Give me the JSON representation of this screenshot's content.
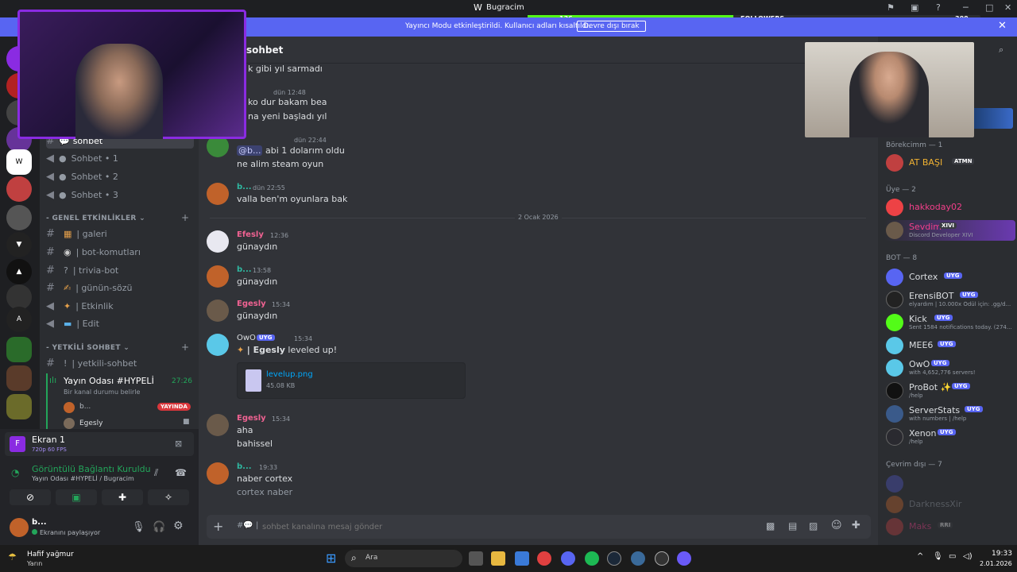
{
  "window": {
    "title": "Bugracim"
  },
  "followers": {
    "current": "136",
    "label": "FOLLOWERS",
    "goal": "300"
  },
  "banner": {
    "message": "Yayıncı Modu etkinleştirildi. Kullanıcı adları kısaltıldı.",
    "button": "Devre dışı bırak"
  },
  "channel_header": {
    "name": "sohbet"
  },
  "channels": {
    "list1": [
      {
        "name": "sohbet",
        "icon": "message-icon"
      },
      {
        "name": "Sohbet • 1",
        "icon": "speaker-icon"
      },
      {
        "name": "Sohbet • 2",
        "icon": "speaker-icon"
      },
      {
        "name": "Sohbet • 3",
        "icon": "speaker-icon"
      }
    ],
    "cat_events": "GENEL ETKİNLİKLER",
    "list2": [
      {
        "name": "galeri"
      },
      {
        "name": "bot-komutları"
      },
      {
        "name": "trivia-bot"
      },
      {
        "name": "günün-sözü"
      },
      {
        "name": "Etkinlik"
      },
      {
        "name": "Edit"
      }
    ],
    "cat_staff": "YETKİLİ SOHBET",
    "list3": [
      {
        "name": "yetkili-sohbet"
      }
    ],
    "voice_room": "Yayın Odası #HYPELİ",
    "voice_time": "27:26",
    "voice_status": "Bir kanal durumu belirle",
    "voice_users": [
      {
        "name": "b..."
      },
      {
        "name": "Egesly"
      }
    ],
    "live_badge": "YAYINDA"
  },
  "screen_panel": {
    "title": "Ekran 1",
    "quality": "720p 60 FPS"
  },
  "connection": {
    "status": "Görüntülü Bağlantı Kuruldu",
    "path": "Yayın Odası #HYPELİ / Bugracim"
  },
  "user_panel": {
    "name": "b...",
    "status": "Ekranını paylaşıyor"
  },
  "messages": {
    "m1": "k gibi yıl sarmadı",
    "m2_time": "dün 12:48",
    "m2a": "ko dur bakam bea",
    "m2b": "na yeni başladı yıl",
    "m3_time": "dün 22:44",
    "m3_mention": "@b...",
    "m3a": "abi 1 dolarım oldu",
    "m3b": "ne alim steam oyun",
    "m4_user": "b...",
    "m4_time": "dün 22:55",
    "m4": "valla ben'm oyunlara bak",
    "divider": "2 Ocak 2026",
    "m5_user": "Efesly",
    "m5_time": "12:36",
    "m5": "günaydın",
    "m6_user": "b...",
    "m6_time": "13:58",
    "m6": "günaydın",
    "m7_user": "Egesly",
    "m7_time": "15:34",
    "m7": "günaydın",
    "m8_user": "OwO",
    "m8_badge": "UYG",
    "m8_time": "15:34",
    "m8_name": "| Egesly",
    "m8": "leveled up!",
    "file_name": "levelup.png",
    "file_size": "45.08 KB",
    "m9_user": "Egesly",
    "m9_time": "15:34",
    "m9a": "aha",
    "m9b": "bahissel",
    "m10_user": "b...",
    "m10_time": "19:33",
    "m10a": "naber cortex",
    "m10b": "cortex naber"
  },
  "input": {
    "placeholder": "sohbet kanalına mesaj gönder"
  },
  "members": {
    "group1": "Börekcimm — 1",
    "g1": [
      {
        "name": "AT BAŞI",
        "tag": "ATMN"
      }
    ],
    "group2": "Üye — 2",
    "g2": [
      {
        "name": "hakkoday02"
      },
      {
        "name": "Sevdim",
        "tag": "XIVI",
        "sub": "Discord Developer XIVI"
      }
    ],
    "group3": "BOT — 8",
    "bots": [
      {
        "name": "Cortex",
        "sub": ""
      },
      {
        "name": "ErensiBOT",
        "sub": "elyardım | 10.000x Ödül için: .gg/d..."
      },
      {
        "name": "Kick",
        "sub": "Sent 1584 notifications today. (274..."
      },
      {
        "name": "MEE6",
        "sub": ""
      },
      {
        "name": "OwO",
        "sub": "with 4,652,776 servers!"
      },
      {
        "name": "ProBot ✨",
        "sub": "/help"
      },
      {
        "name": "ServerStats",
        "sub": "with numbers | /help"
      },
      {
        "name": "Xenon",
        "sub": "/help"
      }
    ],
    "bot_badge": "UYG",
    "group4": "Çevrim dışı — 7",
    "offline": [
      {
        "name": "DarknessXir"
      },
      {
        "name": "Maks",
        "tag": "RRI"
      }
    ]
  },
  "taskbar": {
    "weather": "Hafif yağmur",
    "weather_sub": "Yarın",
    "search": "Ara",
    "time": "19:33",
    "date": "2.01.2026"
  }
}
